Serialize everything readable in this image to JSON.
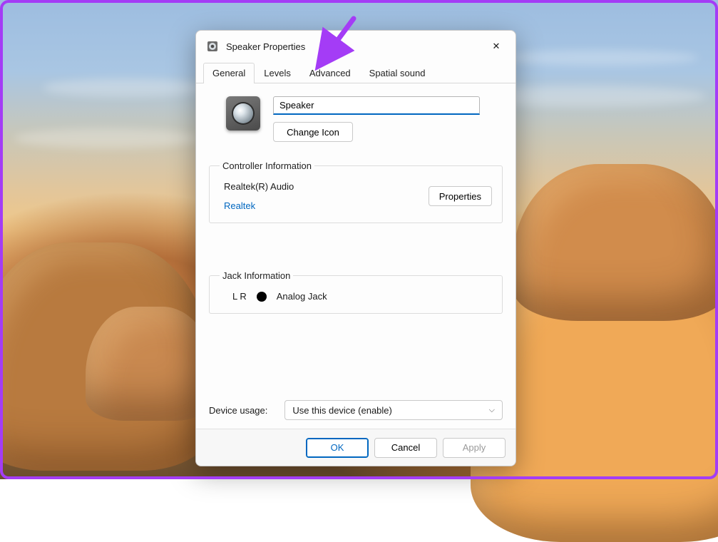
{
  "window": {
    "title": "Speaker Properties",
    "close_glyph": "✕"
  },
  "tabs": {
    "general": "General",
    "levels": "Levels",
    "advanced": "Advanced",
    "spatial": "Spatial sound"
  },
  "general": {
    "device_name": "Speaker",
    "change_icon": "Change Icon",
    "controller_group": "Controller Information",
    "controller_name": "Realtek(R) Audio",
    "controller_vendor": "Realtek",
    "properties_btn": "Properties",
    "jack_group": "Jack Information",
    "jack_channels": "L R",
    "jack_label": "Analog Jack",
    "usage_label": "Device usage:",
    "usage_value": "Use this device (enable)"
  },
  "footer": {
    "ok": "OK",
    "cancel": "Cancel",
    "apply": "Apply"
  },
  "annotation": {
    "target_tab": "advanced",
    "arrow_color": "#a43cf6"
  }
}
